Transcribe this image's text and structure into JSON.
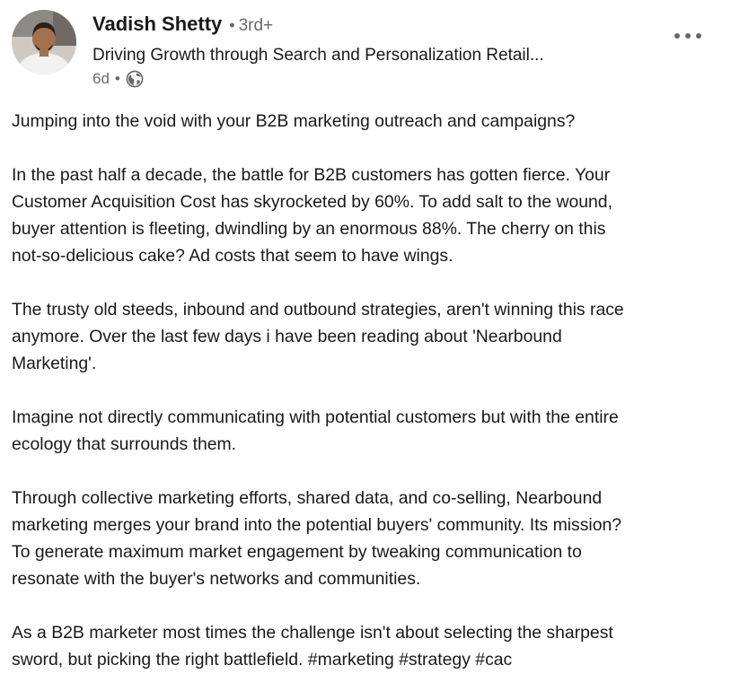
{
  "author": {
    "name": "Vadish Shetty",
    "separator": "•",
    "degree": "3rd+",
    "headline": "Driving Growth through Search and Personalization Retail...",
    "time": "6d",
    "meta_separator": "•",
    "visibility_icon": "globe-icon"
  },
  "menu": {
    "icon": "more-horizontal-icon"
  },
  "post": {
    "paragraphs": [
      {
        "lines": [
          "Jumping into the void with your B2B marketing outreach and campaigns?"
        ]
      },
      {
        "lines": [
          "In the past half a decade, the battle for B2B customers has gotten fierce. Your",
          "Customer Acquisition Cost has skyrocketed by 60%. To add salt to the wound,",
          "buyer attention is fleeting, dwindling by an enormous 88%. The cherry on this",
          "not-so-delicious cake? Ad costs that seem to have wings."
        ]
      },
      {
        "lines": [
          "The trusty old steeds, inbound and outbound strategies, aren't winning this race",
          "anymore. Over the last few days i have been reading about 'Nearbound",
          "Marketing'."
        ]
      },
      {
        "lines": [
          "Imagine not directly communicating with potential customers but with the entire",
          "ecology that surrounds them."
        ]
      },
      {
        "lines": [
          "Through collective marketing efforts, shared data, and co-selling, Nearbound",
          "marketing merges your brand into the potential buyers' community. Its mission?",
          "To generate maximum market engagement by tweaking communication to",
          "resonate with the buyer's networks and communities."
        ]
      },
      {
        "lines": [
          "As a B2B marketer most times the challenge isn't about selecting the sharpest"
        ],
        "last_line_prefix": "sword, but picking the right battlefield. ",
        "hashtags": [
          "#marketing",
          "#strategy",
          "#cac"
        ]
      }
    ]
  },
  "colors": {
    "text_primary": "#191919",
    "text_secondary": "#666666"
  }
}
